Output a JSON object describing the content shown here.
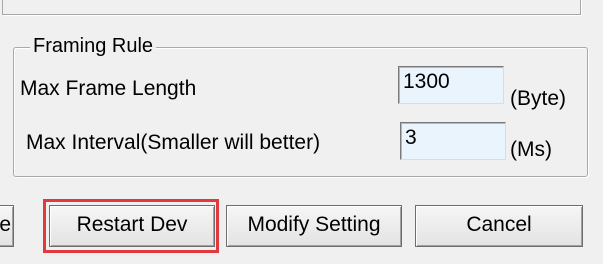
{
  "framing_rule": {
    "title": "Framing Rule",
    "max_frame_length": {
      "label": "Max Frame Length",
      "value": "1300",
      "unit": "(Byte)"
    },
    "max_interval": {
      "label": "Max Interval(Smaller will better)",
      "value": "3",
      "unit": "(Ms)"
    }
  },
  "buttons": {
    "partial_label": "e",
    "restart_dev": "Restart Dev",
    "modify_setting": "Modify Setting",
    "cancel": "Cancel"
  },
  "colors": {
    "highlight": "#e0393e",
    "input_background": "#eaf4fc",
    "window_background": "#f0f0f0"
  }
}
